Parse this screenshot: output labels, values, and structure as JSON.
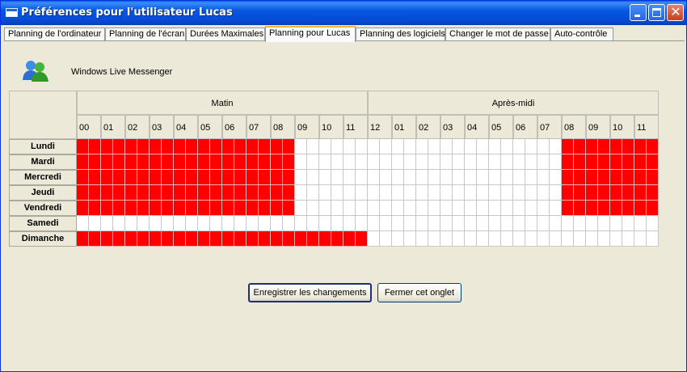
{
  "window": {
    "title": "Préférences pour l'utilisateur Lucas",
    "controls": [
      "minimize",
      "maximize",
      "close"
    ]
  },
  "tabs": [
    {
      "label": "Planning de l'ordinateur",
      "active": false
    },
    {
      "label": "Planning de l'écran",
      "active": false
    },
    {
      "label": "Durées Maximales",
      "active": false
    },
    {
      "label": "Planning  pour Lucas",
      "active": true
    },
    {
      "label": "Planning des logiciels",
      "active": false
    },
    {
      "label": "Changer le mot de passe",
      "active": false
    },
    {
      "label": "Auto-contrôle",
      "active": false
    }
  ],
  "app": {
    "name": "Windows Live Messenger",
    "icon": "messenger-buddies-icon"
  },
  "schedule": {
    "period_morning": "Matin",
    "period_afternoon": "Après-midi",
    "hours": [
      "00",
      "01",
      "02",
      "03",
      "04",
      "05",
      "06",
      "07",
      "08",
      "09",
      "10",
      "11",
      "12",
      "01",
      "02",
      "03",
      "04",
      "05",
      "06",
      "07",
      "08",
      "09",
      "10",
      "11"
    ],
    "slots_per_hour": 2,
    "days": [
      {
        "name": "Lundi",
        "blocked": "111111111111111111000000000000000000000011111111111111111111111110000000001"
      },
      {
        "name": "Mardi",
        "blocked": "111111111111111111000000000000000000000011111111111111111111111110000000001"
      },
      {
        "name": "Mercredi",
        "blocked": "111111111111111111000000000000000000000011111111111111111111111110000000001"
      },
      {
        "name": "Jeudi",
        "blocked": "111111111111111111000000000000000000000011111111111111111111111110000000001"
      },
      {
        "name": "Vendredi",
        "blocked": "111111111111111111000000000000000000000011111111111111111111111110000000001"
      },
      {
        "name": "Samedi",
        "blocked": "000000000000000000000000000000000000000000000000000000000000000000000000000"
      },
      {
        "name": "Dimanche",
        "blocked": "111111111111111111111111000000000000000000000000000000000000000000000000000"
      }
    ],
    "blocked_color": "#ff0000",
    "free_color": "#ffffff"
  },
  "buttons": {
    "save": "Enregistrer les changements",
    "close_tab": "Fermer cet onglet"
  }
}
